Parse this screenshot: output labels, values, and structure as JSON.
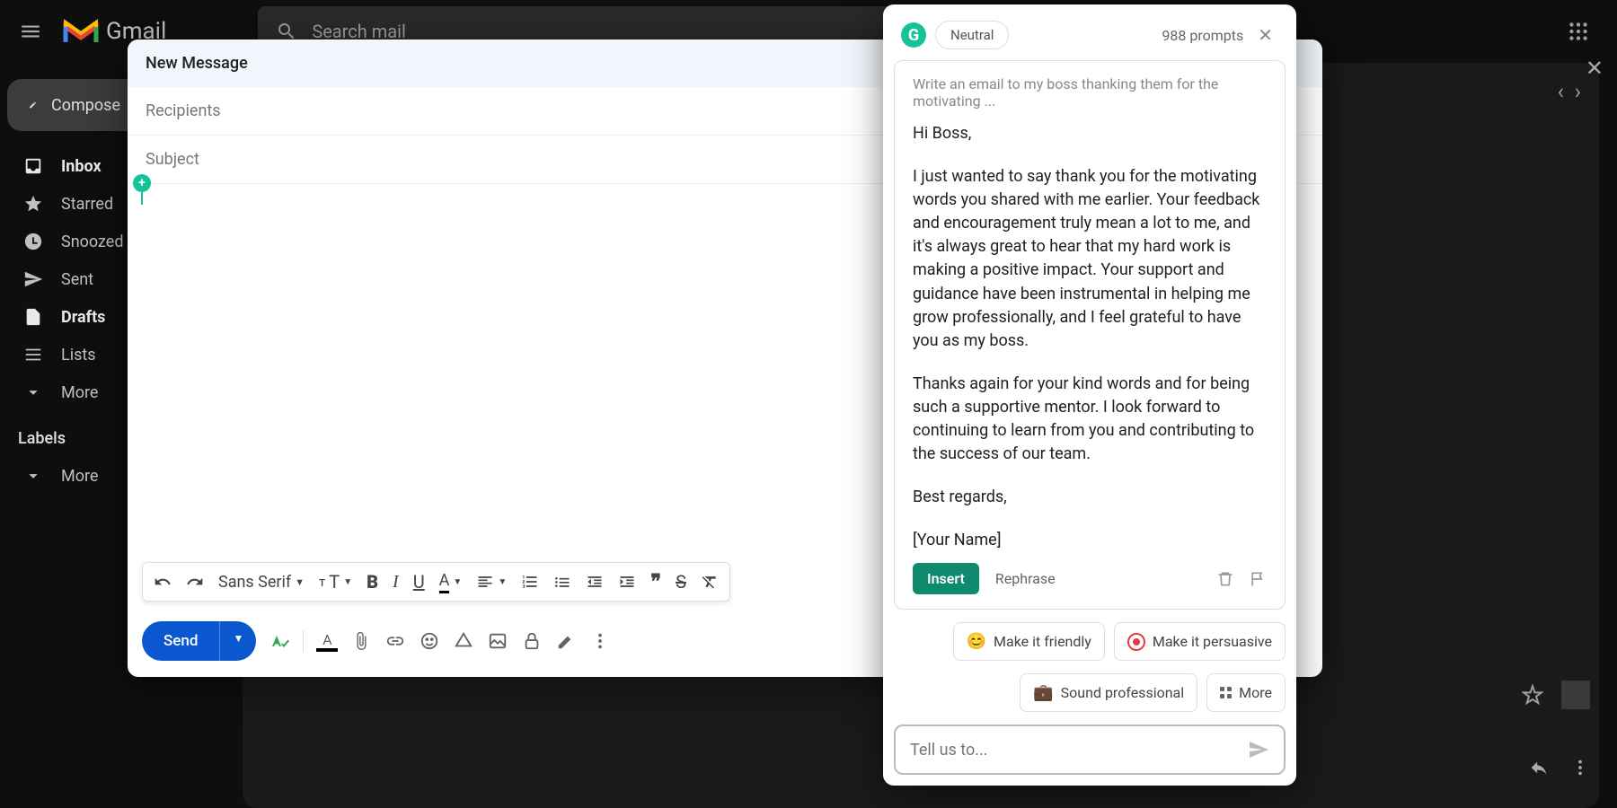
{
  "topbar": {
    "gmail_text": "Gmail",
    "search_placeholder": "Search mail"
  },
  "sidebar": {
    "compose": "Compose",
    "items": [
      {
        "label": "Inbox",
        "bold": true
      },
      {
        "label": "Starred",
        "bold": false
      },
      {
        "label": "Snoozed",
        "bold": false
      },
      {
        "label": "Sent",
        "bold": false
      },
      {
        "label": "Drafts",
        "bold": true
      },
      {
        "label": "Lists",
        "bold": false
      },
      {
        "label": "More",
        "bold": false
      }
    ],
    "labels_header": "Labels",
    "labels_more": "More"
  },
  "compose": {
    "title": "New Message",
    "recipients_placeholder": "Recipients",
    "subject_placeholder": "Subject",
    "font_name": "Sans Serif",
    "send_label": "Send"
  },
  "grammarly": {
    "tone": "Neutral",
    "prompts_count": "988 prompts",
    "prompt_text": "Write an email to my boss thanking them for the motivating ...",
    "greeting": "Hi Boss,",
    "para1": "I just wanted to say thank you for the motivating words you shared with me earlier. Your feedback and encouragement truly mean a lot to me, and it's always great to hear that my hard work is making a positive impact. Your support and guidance have been instrumental in helping me grow professionally, and I feel grateful to have you as my boss.",
    "para2": "Thanks again for your kind words and for being such a supportive mentor. I look forward to continuing to learn from you and contributing to the success of our team.",
    "signoff": "Best regards,",
    "name": "[Your Name]",
    "insert_label": "Insert",
    "rephrase_label": "Rephrase",
    "chip_friendly": "Make it friendly",
    "chip_persuasive": "Make it persuasive",
    "chip_professional": "Sound professional",
    "chip_more": "More",
    "input_placeholder": "Tell us to..."
  }
}
